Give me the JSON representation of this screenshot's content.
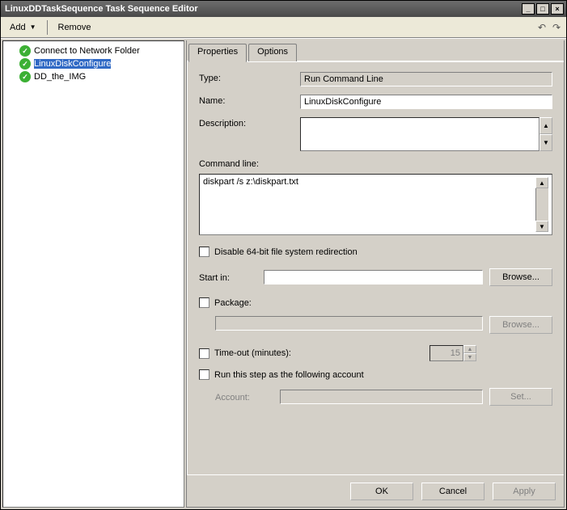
{
  "window": {
    "title": "LinuxDDTaskSequence Task Sequence Editor"
  },
  "titlebar_buttons": {
    "min": "_",
    "max": "□",
    "close": "×"
  },
  "toolbar": {
    "add": "Add",
    "remove": "Remove"
  },
  "tree": {
    "items": [
      {
        "label": "Connect to Network Folder"
      },
      {
        "label": "LinuxDiskConfigure"
      },
      {
        "label": "DD_the_IMG"
      }
    ],
    "selected_index": 1
  },
  "tabs": {
    "properties": "Properties",
    "options": "Options",
    "active": "properties"
  },
  "form": {
    "type_label": "Type:",
    "type_value": "Run Command Line",
    "name_label": "Name:",
    "name_value": "LinuxDiskConfigure",
    "description_label": "Description:",
    "description_value": "",
    "command_line_label": "Command line:",
    "command_line_value": "diskpart /s z:\\diskpart.txt",
    "disable_redir_label": "Disable 64-bit file system redirection",
    "disable_redir_checked": false,
    "start_in_label": "Start in:",
    "start_in_value": "",
    "browse1": "Browse...",
    "package_label": "Package:",
    "package_checked": false,
    "package_value": "",
    "browse2": "Browse...",
    "timeout_label": "Time-out (minutes):",
    "timeout_checked": false,
    "timeout_value": "15",
    "run_as_label": "Run this step as the following account",
    "run_as_checked": false,
    "account_label": "Account:",
    "account_value": "",
    "set_btn": "Set..."
  },
  "footer": {
    "ok": "OK",
    "cancel": "Cancel",
    "apply": "Apply"
  }
}
